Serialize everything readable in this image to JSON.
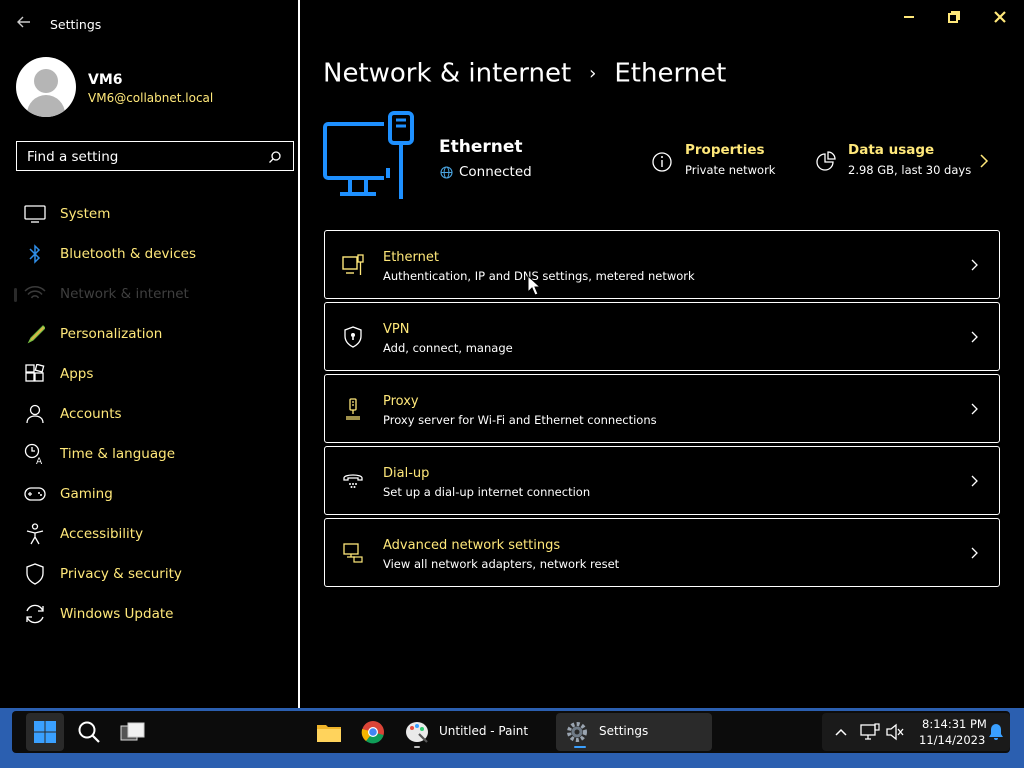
{
  "window": {
    "title": "Settings"
  },
  "user": {
    "name": "VM6",
    "email": "VM6@collabnet.local"
  },
  "search": {
    "placeholder": "Find a setting"
  },
  "sidebar": {
    "items": [
      {
        "label": "System",
        "icon": "monitor-icon"
      },
      {
        "label": "Bluetooth & devices",
        "icon": "bluetooth-icon"
      },
      {
        "label": "Network & internet",
        "icon": "wifi-icon",
        "selected": true
      },
      {
        "label": "Personalization",
        "icon": "brush-icon"
      },
      {
        "label": "Apps",
        "icon": "apps-icon"
      },
      {
        "label": "Accounts",
        "icon": "person-icon"
      },
      {
        "label": "Time & language",
        "icon": "clock-language-icon"
      },
      {
        "label": "Gaming",
        "icon": "gamepad-icon"
      },
      {
        "label": "Accessibility",
        "icon": "accessibility-icon"
      },
      {
        "label": "Privacy & security",
        "icon": "shield-icon"
      },
      {
        "label": "Windows Update",
        "icon": "update-icon"
      }
    ]
  },
  "page": {
    "breadcrumb_parent": "Network & internet",
    "breadcrumb_separator": "›",
    "breadcrumb_current": "Ethernet"
  },
  "header": {
    "title": "Ethernet",
    "status": "Connected",
    "properties": {
      "title": "Properties",
      "subtitle": "Private network"
    },
    "data_usage": {
      "title": "Data usage",
      "subtitle": "2.98 GB, last 30 days"
    }
  },
  "cards": [
    {
      "title": "Ethernet",
      "subtitle": "Authentication, IP and DNS settings, metered network",
      "icon": "ethernet-port-icon"
    },
    {
      "title": "VPN",
      "subtitle": "Add, connect, manage",
      "icon": "vpn-shield-icon"
    },
    {
      "title": "Proxy",
      "subtitle": "Proxy server for Wi-Fi and Ethernet connections",
      "icon": "proxy-icon"
    },
    {
      "title": "Dial-up",
      "subtitle": "Set up a dial-up internet connection",
      "icon": "dialup-icon"
    },
    {
      "title": "Advanced network settings",
      "subtitle": "View all network adapters, network reset",
      "icon": "network-adapter-icon"
    }
  ],
  "taskbar": {
    "apps": [
      {
        "label": "Untitled - Paint",
        "icon": "paint-icon"
      },
      {
        "label": "Settings",
        "icon": "settings-gear-icon"
      }
    ],
    "clock": {
      "time": "8:14:31 PM",
      "date": "11/14/2023"
    }
  },
  "colors": {
    "accent_text": "#ffe87a",
    "icon_blue": "#1e90ff",
    "taskbar_wallpaper": "#2b5fb0"
  }
}
